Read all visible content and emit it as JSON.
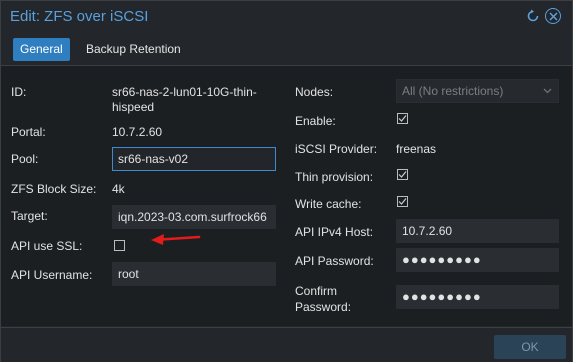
{
  "window": {
    "title": "Edit: ZFS over iSCSI"
  },
  "tabs": [
    {
      "label": "General"
    },
    {
      "label": "Backup Retention"
    }
  ],
  "left": {
    "id_label": "ID:",
    "id_value_line1": "sr66-nas-2-lun01-10G-thin-",
    "id_value_line2": "hispeed",
    "portal_label": "Portal:",
    "portal_value": "10.7.2.60",
    "pool_label": "Pool:",
    "pool_value": "sr66-nas-v02",
    "blocksize_label": "ZFS Block Size:",
    "blocksize_value": "4k",
    "target_label": "Target:",
    "target_value": "iqn.2023-03.com.surfrock66",
    "ssl_label": "API use SSL:",
    "ssl_checked": false,
    "username_label": "API Username:",
    "username_value": "root"
  },
  "right": {
    "nodes_label": "Nodes:",
    "nodes_value": "All (No restrictions)",
    "enable_label": "Enable:",
    "enable_checked": true,
    "provider_label": "iSCSI Provider:",
    "provider_value": "freenas",
    "thin_label": "Thin provision:",
    "thin_checked": true,
    "writecache_label": "Write cache:",
    "writecache_checked": true,
    "host_label": "API IPv4 Host:",
    "host_value": "10.7.2.60",
    "password_label": "API Password:",
    "password_value": "●●●●●●●●●",
    "confirm_label_line1": "Confirm",
    "confirm_label_line2": "Password:",
    "confirm_value": "●●●●●●●●●"
  },
  "footer": {
    "ok_label": "OK"
  },
  "colors": {
    "accent": "#5aa0dc",
    "annotation_arrow": "#e01c1c"
  }
}
